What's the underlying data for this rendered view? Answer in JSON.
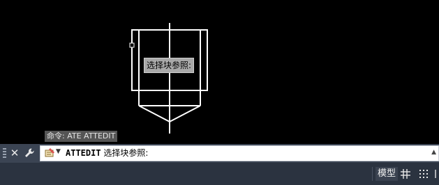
{
  "drawing": {
    "dynamic_prompt": "选择块参照:"
  },
  "command_history": {
    "last_line": "命令: ATE ATTEDIT"
  },
  "command_line": {
    "close_icon": "close-icon",
    "customize_icon": "wrench-icon",
    "recent_commands_icon": "recent-commands-icon",
    "command": "ATTEDIT",
    "prompt": " 选择块参照:"
  },
  "status_bar": {
    "model_label": "模型",
    "grid_icon": "grid-icon",
    "snap_icon": "snap-icon"
  },
  "colors": {
    "canvas_background": "#000000",
    "geometry_stroke": "#ffffff",
    "command_bar": "#3b4453",
    "status_bar": "#2b3340"
  }
}
